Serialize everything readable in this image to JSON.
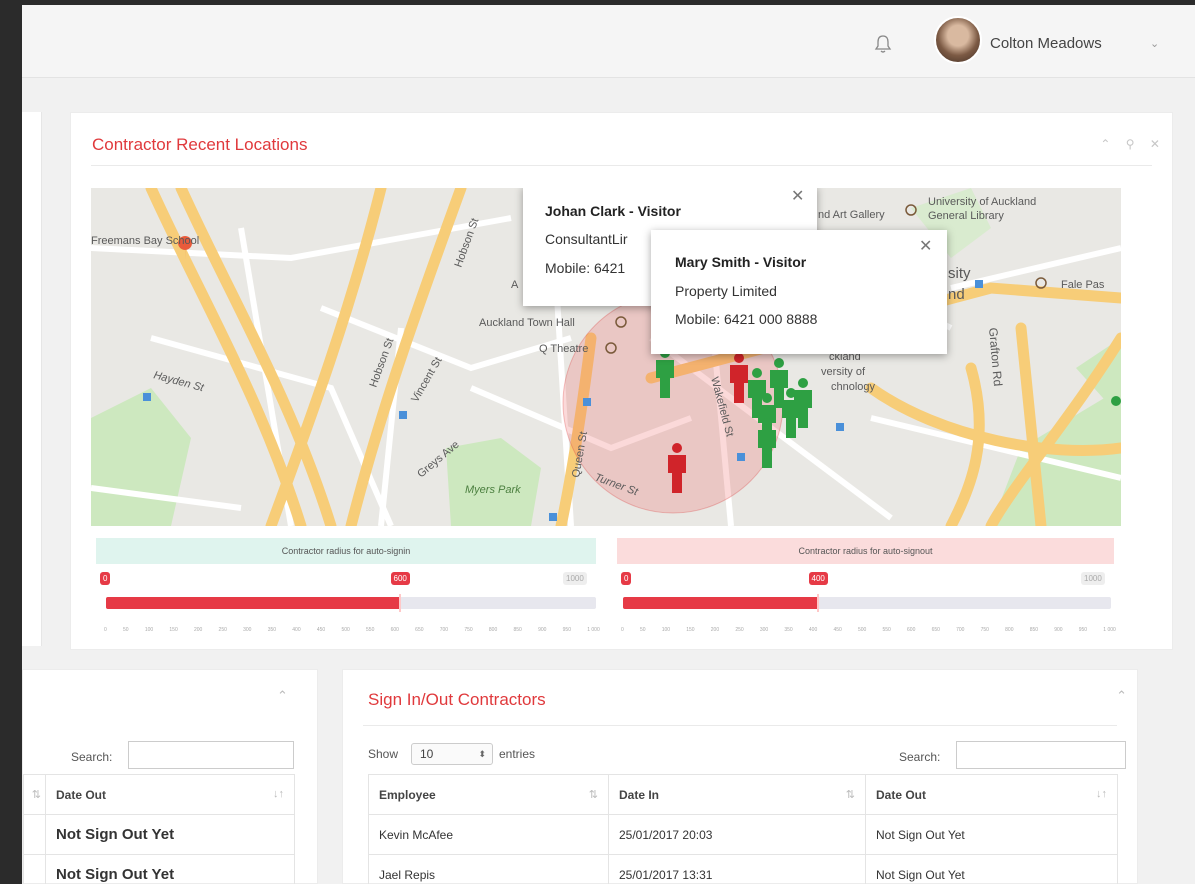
{
  "header": {
    "user_name": "Colton Meadows",
    "icons": [
      "bell-icon",
      "chevron-down-icon"
    ]
  },
  "locations": {
    "title": "Contractor Recent Locations",
    "tools": "⌃ ⚲ ✕",
    "map": {
      "labels": {
        "school": "Freemans Bay School",
        "hobson1": "Hobson St",
        "hobson2": "Hobson St",
        "town_hall": "Auckland Town Hall",
        "theatre": "Q Theatre",
        "hayden": "Hayden St",
        "vincent": "Vincent St",
        "greys": "Greys Ave",
        "myers": "Myers Park",
        "queen": "Queen St",
        "turner": "Turner St",
        "wakefield": "Wakefield St",
        "grafton": "Grafton Rd",
        "art_gallery": "nd Art Gallery",
        "uni_library": "University of Auckland",
        "uni_library2": "General Library",
        "sity": "sity",
        "nd": "nd",
        "fale": "Fale Pas",
        "aut1": "ckland",
        "aut2": "versity of",
        "aut3": "chnology",
        "ad": "A"
      },
      "popups": [
        {
          "title": "Johan Clark - Visitor",
          "line1": "ConsultantLir",
          "line2": "Mobile: 6421"
        },
        {
          "title": "Mary Smith - Visitor",
          "line1": "Property Limited",
          "line2": "Mobile: 6421 000 8888"
        }
      ],
      "popup_close": "✕"
    },
    "signin": {
      "label": "Contractor radius for auto-signin",
      "min": "0",
      "value": "600",
      "max": "1000",
      "value_fraction": 0.6
    },
    "signout": {
      "label": "Contractor radius for auto-signout",
      "min": "0",
      "value": "400",
      "max": "1000",
      "value_fraction": 0.4
    },
    "ticks": [
      "0",
      "50",
      "100",
      "150",
      "200",
      "250",
      "300",
      "350",
      "400",
      "450",
      "500",
      "550",
      "600",
      "650",
      "700",
      "750",
      "800",
      "850",
      "900",
      "950",
      "1 000"
    ]
  },
  "left_table": {
    "collapse": "⌃",
    "search_label": "Search:",
    "header": "Date Out",
    "rows": [
      "Not Sign Out Yet",
      "Not Sign Out Yet"
    ]
  },
  "contractors": {
    "title": "Sign In/Out Contractors",
    "collapse": "⌃",
    "show_label": "Show",
    "show_value": "10",
    "entries_label": "entries",
    "search_label": "Search:",
    "columns": [
      "Employee",
      "Date In",
      "Date Out"
    ],
    "sort_icon": "↓↑",
    "rows": [
      [
        "Kevin McAfee",
        "25/01/2017 20:03",
        "Not Sign Out Yet"
      ],
      [
        "Jael Repis",
        "25/01/2017 13:31",
        "Not Sign Out Yet"
      ]
    ]
  },
  "colors": {
    "accent": "#e0393c",
    "signin_band": "#dff4ee",
    "signout_band": "#fbdcdc",
    "pin_green": "#2ea043",
    "pin_red": "#d0242a"
  }
}
